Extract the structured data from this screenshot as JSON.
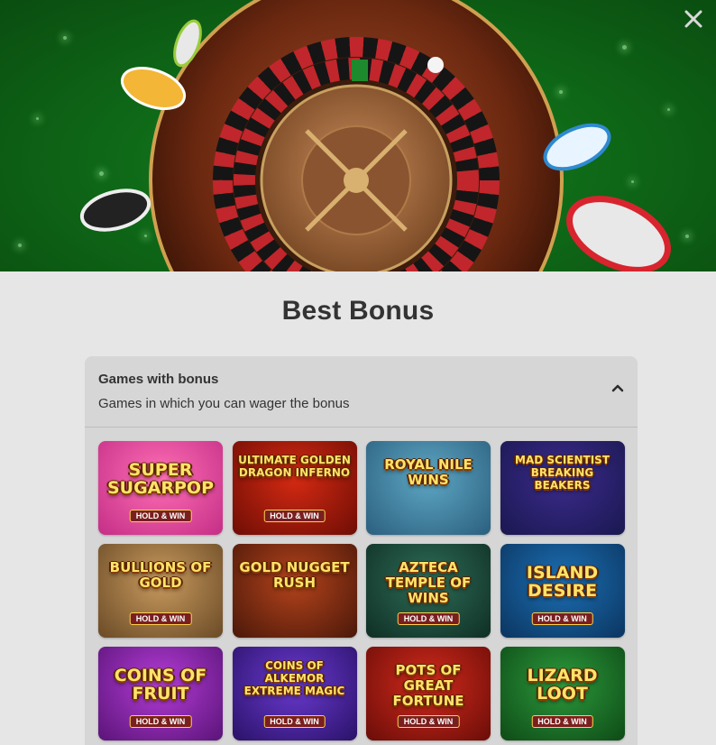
{
  "header": {
    "close_icon": "close-icon"
  },
  "title": "Best Bonus",
  "accordion": {
    "title": "Games with bonus",
    "subtitle": "Games in which you can wager the bonus",
    "chevron_icon": "chevron-up-icon",
    "expanded": true
  },
  "games": [
    {
      "name": "Super SugarPop",
      "badge": "HOLD & WIN",
      "bg1": "#ff6fb5",
      "bg2": "#c42e86"
    },
    {
      "name": "Ultimate Golden Dragon Inferno",
      "badge": "HOLD & WIN",
      "bg1": "#d42a12",
      "bg2": "#6e0d05"
    },
    {
      "name": "Royal Nile Wins",
      "badge": "",
      "bg1": "#5da7c4",
      "bg2": "#2b5f7e"
    },
    {
      "name": "Mad Scientist Breaking Beakers",
      "badge": "",
      "bg1": "#3b2b8c",
      "bg2": "#1a1850"
    },
    {
      "name": "Bullions of Gold",
      "badge": "HOLD & WIN",
      "bg1": "#c89a5e",
      "bg2": "#6a4a26"
    },
    {
      "name": "Gold Nugget Rush",
      "badge": "",
      "bg1": "#b4431c",
      "bg2": "#4a1809"
    },
    {
      "name": "Azteca Temple of Wins",
      "badge": "HOLD & WIN",
      "bg1": "#2e6d57",
      "bg2": "#0f2e25"
    },
    {
      "name": "Island Desire",
      "badge": "HOLD & WIN",
      "bg1": "#1c6fb3",
      "bg2": "#0b3560"
    },
    {
      "name": "Coins of Fruit",
      "badge": "HOLD & WIN",
      "bg1": "#b43cd6",
      "bg2": "#5a1478"
    },
    {
      "name": "Coins of Alkemor Extreme Magic",
      "badge": "HOLD & WIN",
      "bg1": "#6a3ad0",
      "bg2": "#2a1268"
    },
    {
      "name": "Pots of Great Fortune",
      "badge": "HOLD & WIN",
      "bg1": "#d22a1c",
      "bg2": "#6a0d08"
    },
    {
      "name": "Lizard Loot",
      "badge": "HOLD & WIN",
      "bg1": "#2c9a3c",
      "bg2": "#0e4a16"
    }
  ]
}
